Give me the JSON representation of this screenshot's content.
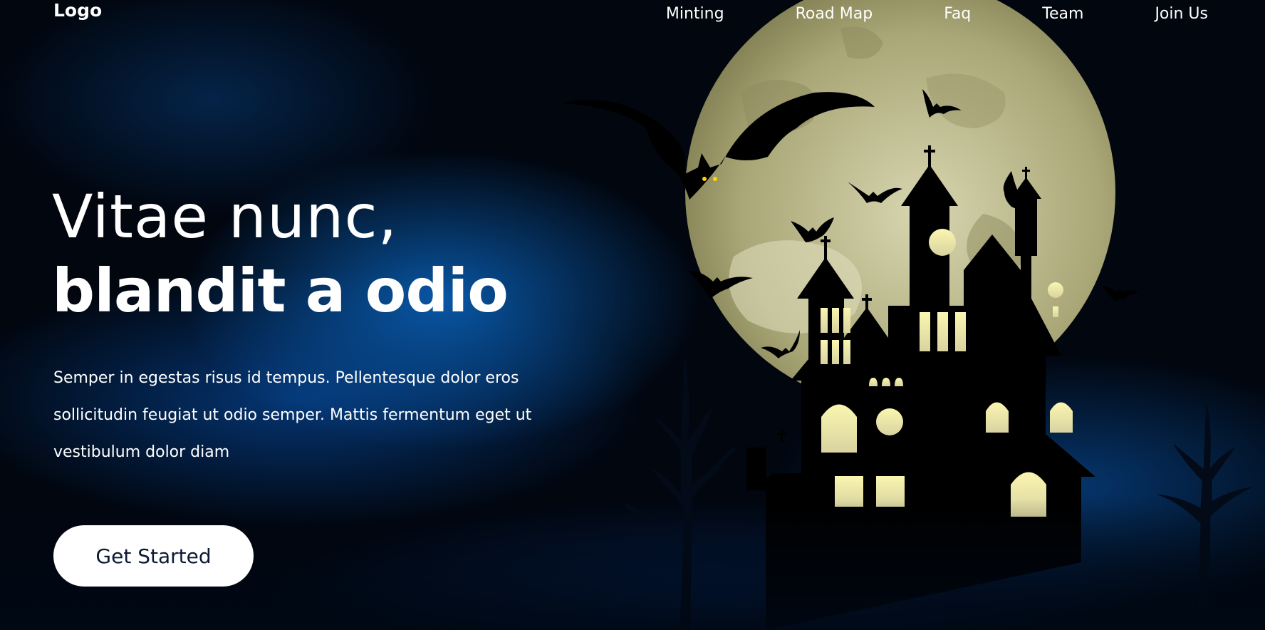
{
  "header": {
    "logo": "Logo",
    "nav": [
      {
        "label": "Minting"
      },
      {
        "label": "Road Map"
      },
      {
        "label": "Faq"
      },
      {
        "label": "Team"
      },
      {
        "label": "Join Us"
      }
    ]
  },
  "hero": {
    "title_line1": "Vitae nunc,",
    "title_line2": "blandit a odio",
    "description": "Semper in egestas risus id tempus. Pellentesque dolor eros sollicitudin feugiat ut odio semper. Mattis fermentum eget ut vestibulum dolor diam",
    "cta_label": "Get Started"
  },
  "colors": {
    "background": "#01060f",
    "glow": "#0a64be",
    "moon": "#c7c596",
    "window_light": "#f7f2a6",
    "text": "#ffffff",
    "button_text": "#0b1a33"
  },
  "icons": {
    "illustration": "haunted-castle-illustration"
  }
}
